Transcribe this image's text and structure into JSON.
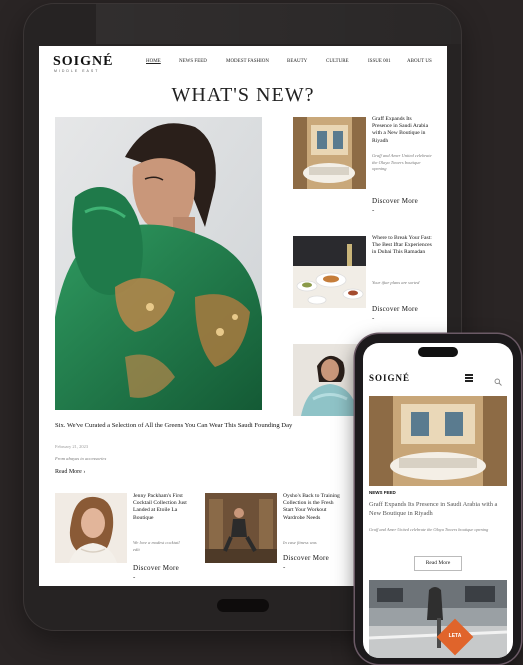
{
  "site": {
    "logo": "SOIGNÉ",
    "logo_sub": "MIDDLE EAST",
    "nav": [
      "HOME",
      "NEWS FEED",
      "MODEST FASHION",
      "BEAUTY",
      "CULTURE",
      "ISSUE 001",
      "ABOUT US"
    ],
    "headline": "WHAT'S NEW?"
  },
  "feature": {
    "title": "Six. We've Curated a Selection of All the Greens You Can Wear This Saudi Founding Day",
    "date": "February 21, 2023",
    "subtitle": "From abayas to accessories",
    "read_more": "Read More ›"
  },
  "side_articles": [
    {
      "title": "Graff Expands Its Presence in Saudi Arabia with a New Boutique in Riyadh",
      "subtitle": "Graff and Amer United celebrate the Olaya Towers boutique opening",
      "cta": "Discover More",
      "dash": "-"
    },
    {
      "title": "Where to Break Your Fast: The Best Iftar Experiences in Dubai This Ramadan",
      "subtitle": "Your iftar plans are sorted",
      "cta": "Discover More",
      "dash": "-"
    }
  ],
  "bottom_articles": [
    {
      "title": "Jenny Packham's First Cocktail Collection Just Landed at Etoile La Boutique",
      "subtitle": "We love a modest cocktail edit",
      "cta": "Discover More",
      "dash": "-"
    },
    {
      "title": "Oysho's Back to Training Collection is the Fresh Start Your Workout Wardrobe Needs",
      "subtitle": "In case fitness was",
      "cta": "Discover More",
      "dash": "-"
    }
  ],
  "phone": {
    "logo": "SOIGNÉ",
    "section": "NEWS FEED",
    "title": "Graff Expands Its Presence in Saudi Arabia with a New Boutique in Riyadh",
    "subtitle": "Graff and Amer United celebrate the Olaya Towers boutique opening",
    "read_more": "Read More",
    "badge": "LETA"
  },
  "colors": {
    "device_frame": "#262323",
    "background": "#2a2525",
    "green_garment": "#1f7a4a",
    "gold_embroidery": "#b8864a",
    "phone_frame_accent": "#6b5a66",
    "badge_orange": "#e0642b"
  },
  "icons": {
    "phone_menu": "hamburger-icon",
    "phone_search": "search-icon"
  }
}
